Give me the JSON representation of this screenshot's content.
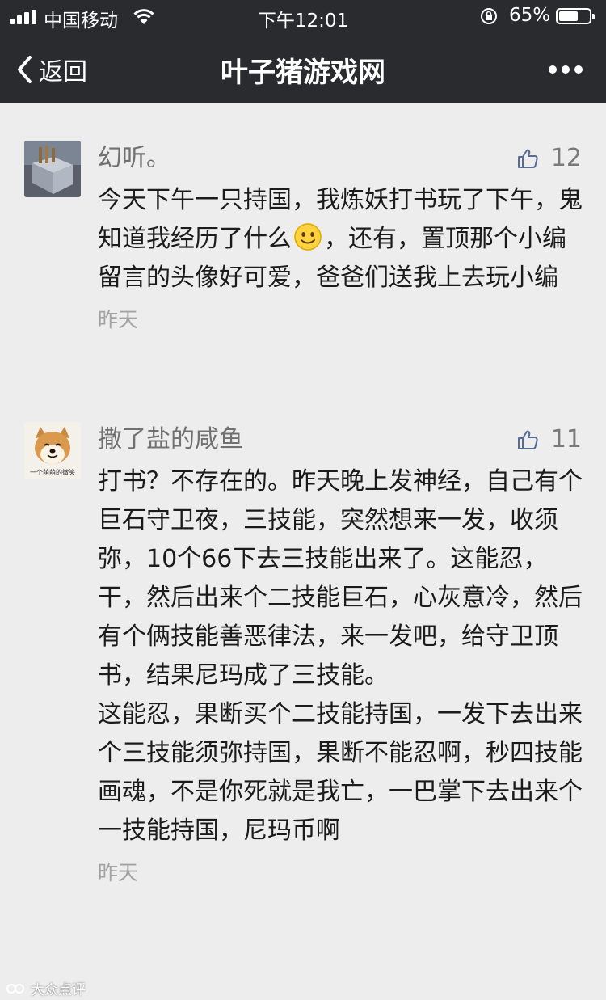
{
  "status_bar": {
    "carrier": "中国移动",
    "time": "下午12:01",
    "battery_percent": "65%",
    "battery_level": 0.65
  },
  "nav": {
    "back_label": "返回",
    "title": "叶子猪游戏网"
  },
  "comments": [
    {
      "username": "幻听。",
      "likes": "12",
      "text_part1": "今天下午一只持国，我炼妖打书玩了下午，鬼知道我经历了什么",
      "text_part2": "，还有，置顶那个小编留言的头像好可爱，爸爸们送我上去玩小编",
      "date": "昨天"
    },
    {
      "username": "撒了盐的咸鱼",
      "likes": "11",
      "avatar_caption": "一个萌萌的微笑",
      "text": "打书？不存在的。昨天晚上发神经，自己有个巨石守卫夜，三技能，突然想来一发，收须弥，10个66下去三技能出来了。这能忍，干，然后出来个二技能巨石，心灰意冷，然后有个俩技能善恶律法，来一发吧，给守卫顶书，结果尼玛成了三技能。\n这能忍，果断买个二技能持国，一发下去出来个三技能须弥持国，果断不能忍啊，秒四技能画魂，不是你死就是我亡，一巴掌下去出来个一技能持国，尼玛币啊",
      "date": "昨天"
    }
  ],
  "watermark": "大众点评"
}
